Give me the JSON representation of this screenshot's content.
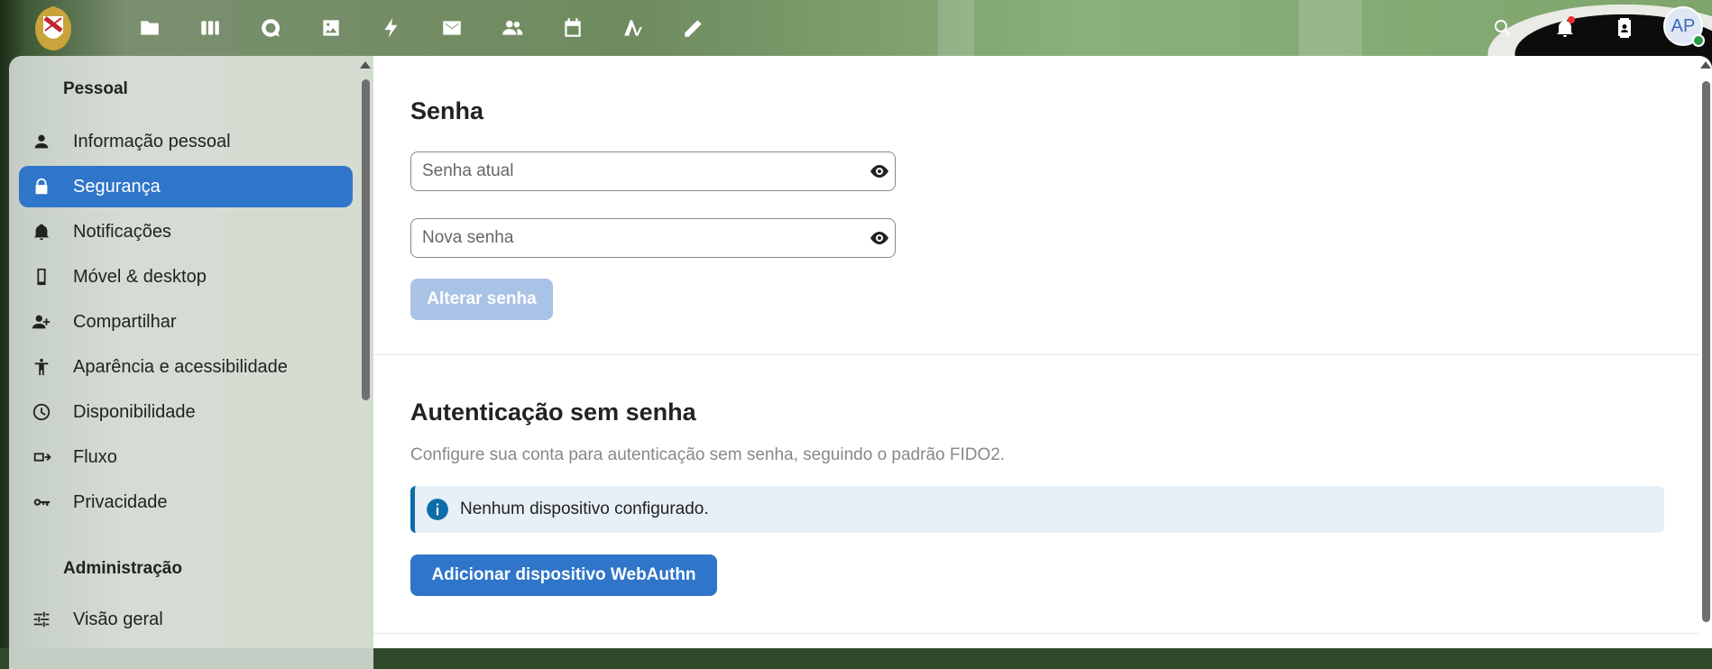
{
  "header": {
    "apps": [
      {
        "name": "files-icon"
      },
      {
        "name": "deck-icon"
      },
      {
        "name": "talk-icon"
      },
      {
        "name": "photos-icon"
      },
      {
        "name": "activity-icon"
      },
      {
        "name": "mail-icon"
      },
      {
        "name": "contacts-icon"
      },
      {
        "name": "calendar-icon"
      },
      {
        "name": "text-icon"
      },
      {
        "name": "notes-icon"
      }
    ],
    "avatar_initials": "AP"
  },
  "sidebar": {
    "personal_caption": "Pessoal",
    "items": [
      {
        "label": "Informação pessoal",
        "icon": "person-icon"
      },
      {
        "label": "Segurança",
        "icon": "lock-icon",
        "active": true
      },
      {
        "label": "Notificações",
        "icon": "bell-icon"
      },
      {
        "label": "Móvel & desktop",
        "icon": "phone-icon"
      },
      {
        "label": "Compartilhar",
        "icon": "share-icon"
      },
      {
        "label": "Aparência e acessibilidade",
        "icon": "accessibility-icon"
      },
      {
        "label": "Disponibilidade",
        "icon": "clock-icon"
      },
      {
        "label": "Fluxo",
        "icon": "flow-icon"
      },
      {
        "label": "Privacidade",
        "icon": "key-icon"
      }
    ],
    "admin_caption": "Administração",
    "admin_items": [
      {
        "label": "Visão geral",
        "icon": "tune-icon"
      }
    ]
  },
  "password": {
    "title": "Senha",
    "current_placeholder": "Senha atual",
    "new_placeholder": "Nova senha",
    "change_button": "Alterar senha"
  },
  "passwordless": {
    "title": "Autenticação sem senha",
    "description": "Configure sua conta para autenticação sem senha, seguindo o padrão FIDO2.",
    "info": "Nenhum dispositivo configurado.",
    "add_button": "Adicionar dispositivo WebAuthn"
  },
  "colors": {
    "accent": "#2f75c9",
    "info_border": "#0d6da8",
    "info_bg": "#e6f0f6"
  }
}
